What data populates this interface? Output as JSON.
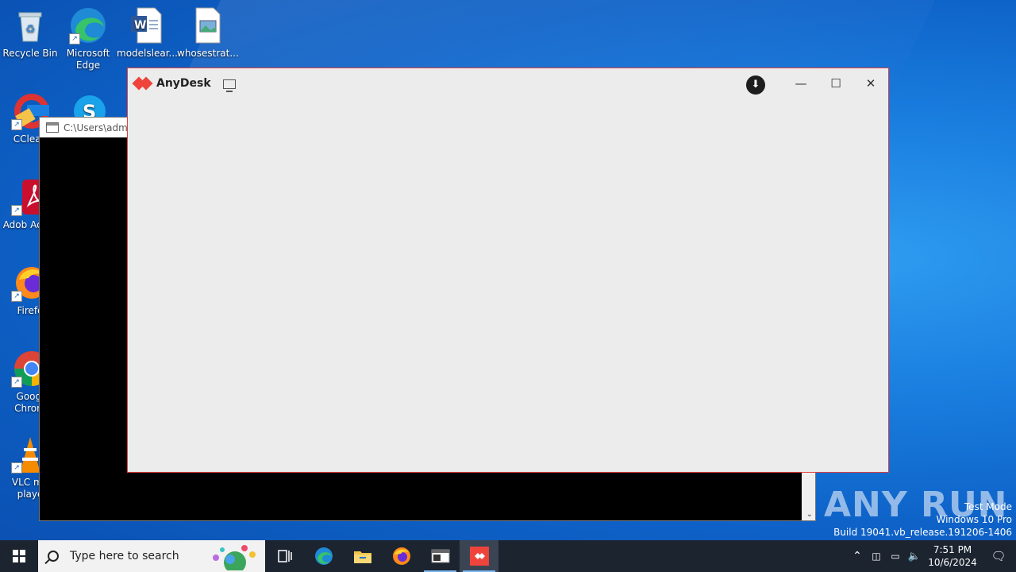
{
  "desktop": {
    "icons": [
      {
        "label": "Recycle Bin"
      },
      {
        "label": "Microsoft Edge"
      },
      {
        "label": "modelslear..."
      },
      {
        "label": "whosestrat..."
      },
      {
        "label": "CClean"
      },
      {
        "label": "Adob Acrob"
      },
      {
        "label": "Firefo"
      },
      {
        "label": "Googl Chrom"
      },
      {
        "label": "VLC me playe"
      }
    ]
  },
  "console": {
    "title": "C:\\Users\\admin"
  },
  "anydesk": {
    "title": "AnyDesk"
  },
  "taskbar": {
    "search_placeholder": "Type here to search",
    "time": "7:51 PM",
    "date": "10/6/2024"
  },
  "watermark": {
    "line1": "Test Mode",
    "line2": "Windows 10 Pro",
    "line3": "Build 19041.vb_release.191206-1406",
    "brand": "ANY RUN"
  },
  "colors": {
    "anydesk_red": "#ef443b",
    "taskbar": "#1c2430"
  }
}
